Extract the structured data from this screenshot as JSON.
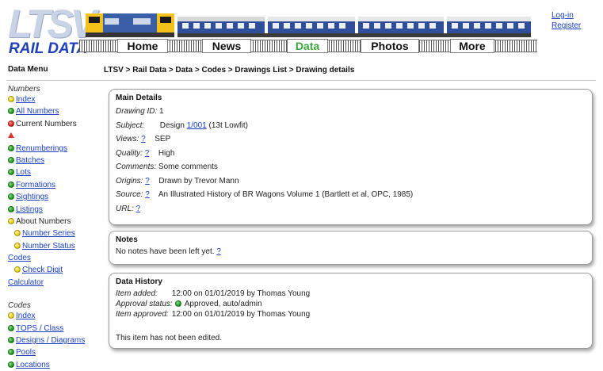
{
  "header": {
    "logo_text": "LTSV",
    "logo_subtitle": "RAIL DATA",
    "nav": [
      {
        "label": "Home"
      },
      {
        "label": "News"
      },
      {
        "label": "Data"
      },
      {
        "label": "Photos"
      },
      {
        "label": "More"
      }
    ],
    "login": "Log-in",
    "register": "Register",
    "accent_color": "#3aa63a",
    "brand_color": "#1f3fb8"
  },
  "sidebar": {
    "title": "Data Menu",
    "numbers_heading": "Numbers",
    "numbers_items": [
      {
        "label": "Index",
        "icon": "yellow"
      },
      {
        "label": "All Numbers",
        "icon": "green"
      },
      {
        "label": "Current Numbers",
        "icon": "red"
      },
      {
        "label": "",
        "icon": "warning"
      },
      {
        "label": "Renumberings",
        "icon": "green"
      },
      {
        "label": "Batches",
        "icon": "green"
      },
      {
        "label": "Lots",
        "icon": "green"
      },
      {
        "label": "Formations",
        "icon": "green"
      },
      {
        "label": "Sightings",
        "icon": "green"
      },
      {
        "label": "Listings",
        "icon": "green"
      },
      {
        "label": "About Numbers",
        "icon": "yellow"
      }
    ],
    "about_sub": {
      "number_series": "Number Series",
      "number_status": "Number Status",
      "codes": "Codes",
      "check_digit": "Check Digit",
      "calculator": "Calculator"
    },
    "codes_heading": "Codes",
    "codes_items": [
      {
        "label": "Index",
        "icon": "yellow"
      },
      {
        "label": "TOPS / Class",
        "icon": "green"
      },
      {
        "label": "Designs / Diagrams",
        "icon": "green"
      },
      {
        "label": "Pools",
        "icon": "green"
      },
      {
        "label": "Locations",
        "icon": "green"
      }
    ]
  },
  "breadcrumb": "LTSV > Rail Data > Data > Codes > Drawings List > Drawing details",
  "main_details": {
    "title": "Main Details",
    "drawing_id_label": "Drawing ID:",
    "drawing_id": "1",
    "subject_label": "Subject:",
    "subject_prefix": "Design",
    "subject_link": "1/001",
    "subject_suffix": "(13t Lowfit)",
    "views_label": "Views:",
    "views": "SEP",
    "quality_label": "Quality:",
    "quality": "High",
    "comments_label": "Comments:",
    "comments": "Some comments",
    "origins_label": "Origins:",
    "origins": "Drawn by Trevor Mann",
    "source_label": "Source:",
    "source": "An Illustrated History of BR Wagons Volume 1 (Bartlett et al, OPC, 1985)",
    "url_label": "URL:",
    "help": "?"
  },
  "notes": {
    "title": "Notes",
    "text": "No notes have been left yet.",
    "help": "?"
  },
  "history": {
    "title": "Data History",
    "added_label": "Item added:",
    "added": "12:00 on 01/01/2019 by Thomas Young",
    "approval_label": "Approval status:",
    "approval": "Approved, auto/admin",
    "approved_label": "Item approved:",
    "approved": "12:00 on 01/01/2019 by Thomas Young",
    "edited": "This item has not been edited."
  }
}
